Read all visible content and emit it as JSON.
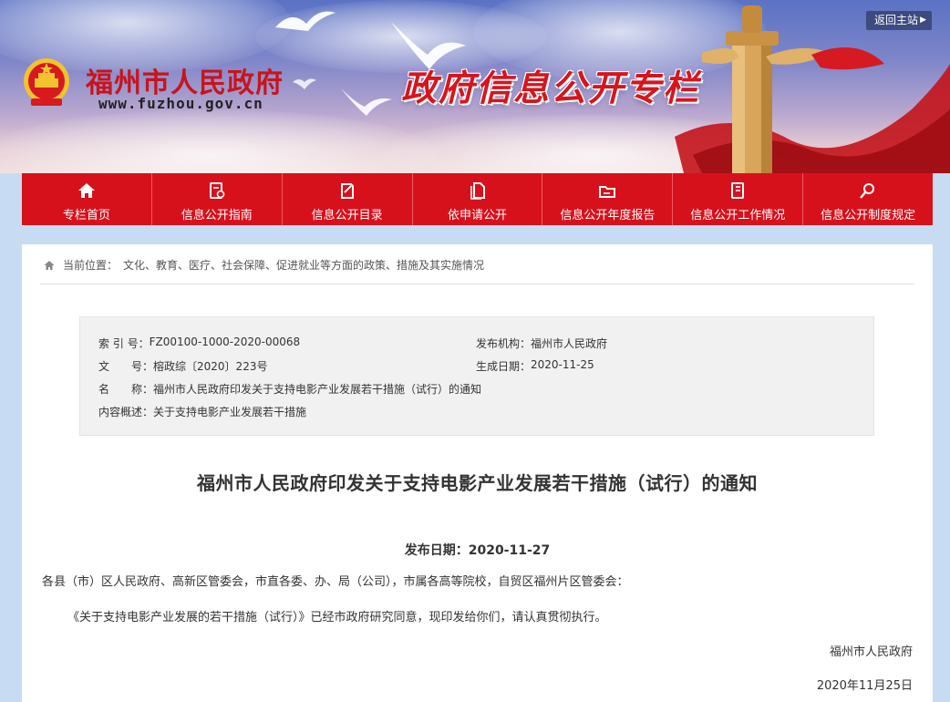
{
  "header": {
    "site_name": "福州市人民政府",
    "site_url": "www.fuzhou.gov.cn",
    "banner_title": "政府信息公开专栏",
    "return_label": "返回主站"
  },
  "nav": {
    "items": [
      {
        "label": "专栏首页",
        "icon": "home-icon"
      },
      {
        "label": "信息公开指南",
        "icon": "guide-icon"
      },
      {
        "label": "信息公开目录",
        "icon": "catalog-icon"
      },
      {
        "label": "依申请公开",
        "icon": "document-icon"
      },
      {
        "label": "信息公开年度报告",
        "icon": "report-icon"
      },
      {
        "label": "信息公开工作情况",
        "icon": "work-icon"
      },
      {
        "label": "信息公开制度规定",
        "icon": "regulation-icon"
      }
    ]
  },
  "breadcrumb": {
    "prefix": "当前位置：",
    "path": "文化、教育、医疗、社会保障、促进就业等方面的政策、措施及其实施情况"
  },
  "meta": {
    "index_label": "索 引 号：",
    "index_value": "FZ00100-1000-2020-00068",
    "publisher_label": "发布机构：",
    "publisher_value": "福州市人民政府",
    "docno_label": "文　　号：",
    "docno_value": "榕政综〔2020〕223号",
    "created_label": "生成日期：",
    "created_value": "2020-11-25",
    "name_label": "名　　称：",
    "name_value": "福州市人民政府印发关于支持电影产业发展若干措施（试行）的通知",
    "summary_label": "内容概述：",
    "summary_value": "关于支持电影产业发展若干措施"
  },
  "article": {
    "title": "福州市人民政府印发关于支持电影产业发展若干措施（试行）的通知",
    "publish_date": "发布日期：2020-11-27",
    "salutation": "各县（市）区人民政府、高新区管委会，市直各委、办、局（公司），市属各高等院校，自贸区福州片区管委会：",
    "body": "《关于支持电影产业发展的若干措施（试行）》已经市政府研究同意，现印发给你们，请认真贯彻执行。",
    "signer": "福州市人民政府",
    "sign_date": "2020年11月25日"
  },
  "colors": {
    "nav_red": "#d7111c",
    "title_red": "#d7141d"
  }
}
